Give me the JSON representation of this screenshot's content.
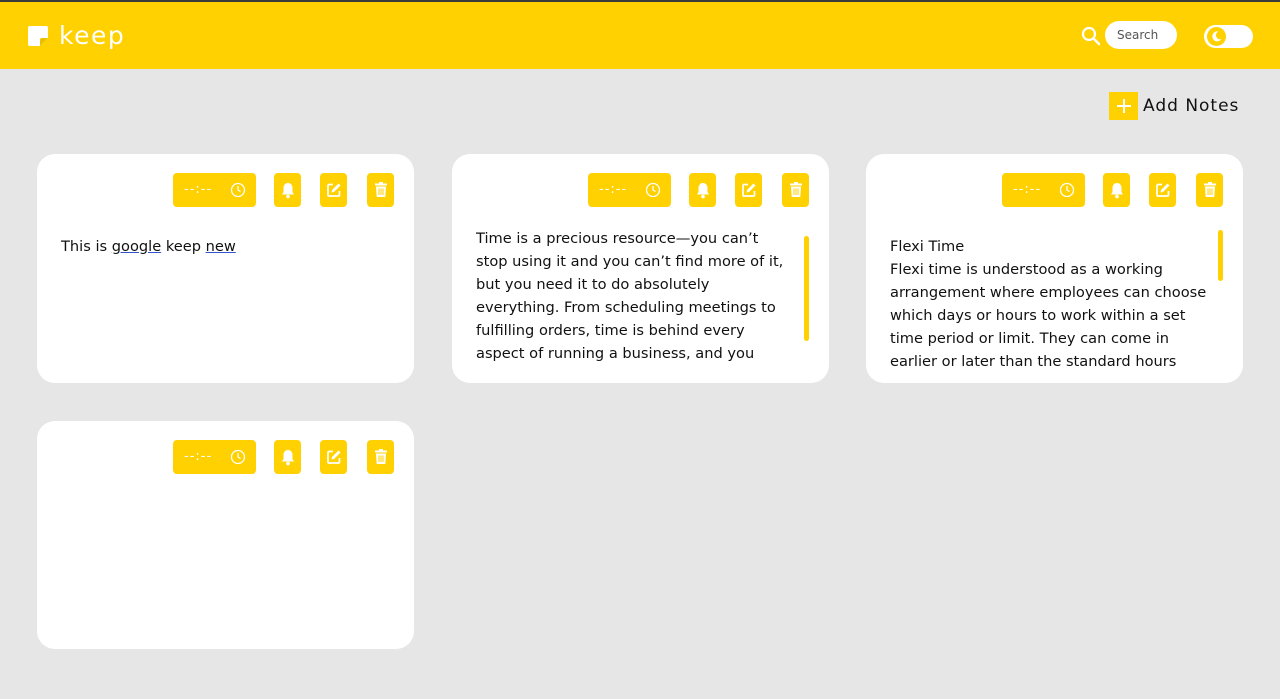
{
  "app": {
    "name": "keep"
  },
  "header": {
    "search_placeholder": "Search"
  },
  "actions": {
    "add_notes_label": "Add Notes"
  },
  "colors": {
    "accent": "#ffd100",
    "background": "#e6e6e6",
    "card": "#ffffff"
  },
  "notes": [
    {
      "time_value": "--:--",
      "text_parts": [
        "This is ",
        "google",
        " keep ",
        "new"
      ]
    },
    {
      "time_value": "--:--",
      "text": "Time is a precious resource—you can’t stop using it and you can’t find more of it, but you need it to do absolutely everything. From scheduling meetings to fulfilling orders, time is behind every aspect of running a business, and you"
    },
    {
      "time_value": "--:--",
      "title": "Flexi Time",
      "text": "Flexi time is understood as a working arrangement where employees can choose which days or hours to work within a set time period or limit. They can come in earlier or later than the standard hours"
    },
    {
      "time_value": "--:--",
      "text": ""
    }
  ],
  "icons": {
    "logo": "note-icon",
    "search": "search-icon",
    "theme": "moon-icon",
    "add": "plus-icon",
    "clock": "clock-icon",
    "bell": "bell-icon",
    "edit": "edit-icon",
    "delete": "trash-icon"
  }
}
